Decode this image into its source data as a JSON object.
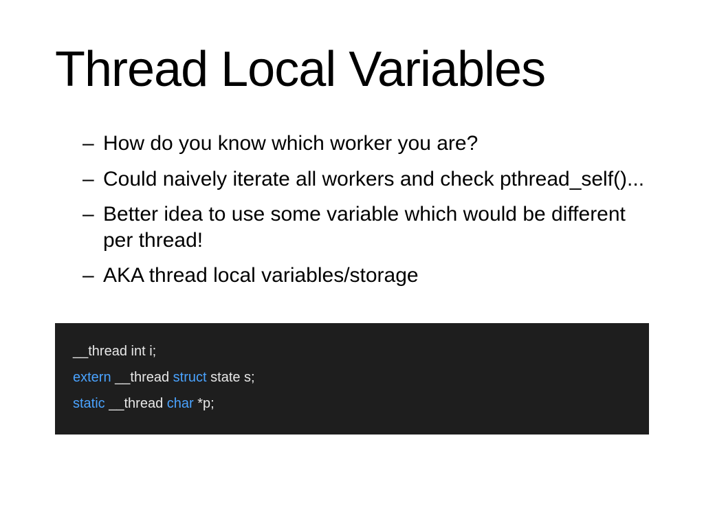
{
  "title": "Thread Local Variables",
  "bullets": [
    "How do you know which worker you are?",
    "Could naively iterate all workers and check pthread_self()...",
    "Better idea to use some variable which would be different per thread!",
    "AKA thread local variables/storage"
  ],
  "code": {
    "line1": {
      "t1": "__thread int i;"
    },
    "line2": {
      "kw1": "extern",
      "t1": " __thread ",
      "kw2": "struct",
      "t2": " state s;"
    },
    "line3": {
      "kw1": "static",
      "t1": " __thread ",
      "kw2": "char",
      "t2": " *p;"
    }
  }
}
